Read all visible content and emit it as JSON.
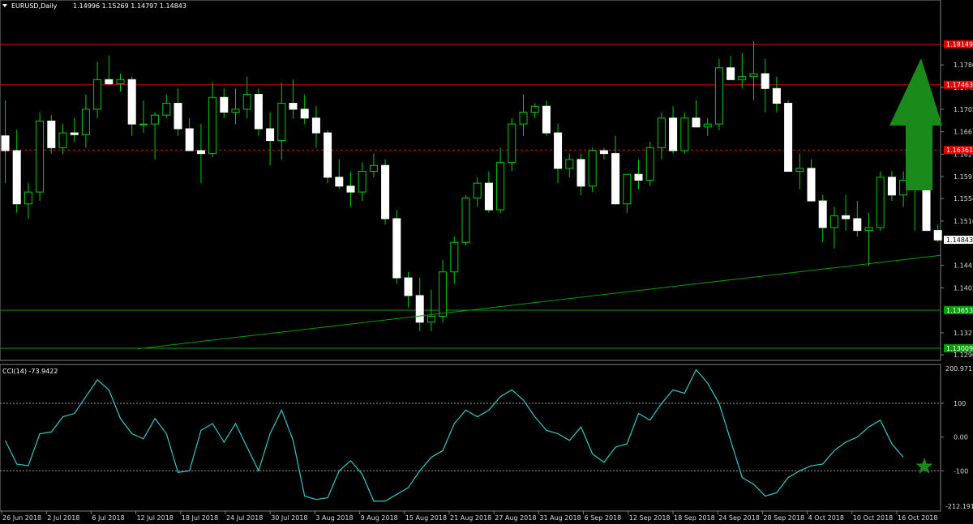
{
  "header": {
    "symbol": "EURUSD,Daily",
    "ohlc": "1.14996 1.15269 1.14797 1.14843"
  },
  "indicator": {
    "label": "CCI(14) -73.9422",
    "top_label": "200.9715",
    "bottom_label": "-212.1911"
  },
  "colors": {
    "background": "#000000",
    "candle_up": "#000000",
    "candle_down": "#ffffff",
    "candle_outline": "#00cc00",
    "resistance": "#e00000",
    "support": "#00a000",
    "trendline": "#00a000",
    "cci_line": "#32c8c8",
    "arrow": "#1a8a1a",
    "star": "#1a8a1a"
  },
  "chart_data": [
    {
      "type": "candlestick",
      "title": "EURUSD,Daily",
      "ylim": [
        1.129,
        1.1865
      ],
      "y_ticks": [
        "1.17800",
        "1.17420",
        "1.17050",
        "1.16670",
        "1.16290",
        "1.15910",
        "1.15540",
        "1.15160",
        "1.14410",
        "1.14030",
        "1.13270",
        "1.12900"
      ],
      "x_ticks": [
        "26 Jun 2018",
        "2 Jul 2018",
        "6 Jul 2018",
        "12 Jul 2018",
        "18 Jul 2018",
        "24 Jul 2018",
        "30 Jul 2018",
        "3 Aug 2018",
        "9 Aug 2018",
        "15 Aug 2018",
        "21 Aug 2018",
        "27 Aug 2018",
        "31 Aug 2018",
        "6 Sep 2018",
        "12 Sep 2018",
        "18 Sep 2018",
        "24 Sep 2018",
        "28 Sep 2018",
        "4 Oct 2018",
        "10 Oct 2018",
        "16 Oct 2018"
      ],
      "price_labels": [
        {
          "text": "1.18149",
          "value": 1.18149,
          "kind": "resistance"
        },
        {
          "text": "1.17463",
          "value": 1.17463,
          "kind": "resistance"
        },
        {
          "text": "1.16361",
          "value": 1.16361,
          "kind": "resistance-dashed"
        },
        {
          "text": "1.14843",
          "value": 1.14843,
          "kind": "current"
        },
        {
          "text": "1.13653",
          "value": 1.13653,
          "kind": "support"
        },
        {
          "text": "1.13009",
          "value": 1.13009,
          "kind": "support"
        }
      ],
      "trendline": {
        "from": [
          9,
          1.13
        ],
        "to": [
          80,
          1.1458
        ]
      },
      "arrow": "up",
      "candles": [
        [
          1.166,
          1.172,
          1.158,
          1.1635
        ],
        [
          1.1635,
          1.167,
          1.153,
          1.1545
        ],
        [
          1.1545,
          1.158,
          1.152,
          1.1565
        ],
        [
          1.1565,
          1.17,
          1.155,
          1.1685
        ],
        [
          1.1685,
          1.1695,
          1.163,
          1.164
        ],
        [
          1.164,
          1.168,
          1.163,
          1.1665
        ],
        [
          1.1665,
          1.169,
          1.165,
          1.1662
        ],
        [
          1.1662,
          1.173,
          1.164,
          1.1705
        ],
        [
          1.1705,
          1.1785,
          1.169,
          1.1755
        ],
        [
          1.1755,
          1.1795,
          1.1745,
          1.1748
        ],
        [
          1.1748,
          1.1765,
          1.1735,
          1.1755
        ],
        [
          1.1755,
          1.176,
          1.166,
          1.168
        ],
        [
          1.168,
          1.172,
          1.1665,
          1.168
        ],
        [
          1.168,
          1.17,
          1.162,
          1.1695
        ],
        [
          1.1695,
          1.173,
          1.169,
          1.1715
        ],
        [
          1.1715,
          1.174,
          1.166,
          1.1672
        ],
        [
          1.1672,
          1.169,
          1.164,
          1.1635
        ],
        [
          1.1635,
          1.168,
          1.158,
          1.163
        ],
        [
          1.163,
          1.175,
          1.1625,
          1.1725
        ],
        [
          1.1725,
          1.174,
          1.169,
          1.17
        ],
        [
          1.17,
          1.174,
          1.168,
          1.1705
        ],
        [
          1.1705,
          1.176,
          1.169,
          1.173
        ],
        [
          1.173,
          1.174,
          1.166,
          1.1672
        ],
        [
          1.1672,
          1.17,
          1.161,
          1.1652
        ],
        [
          1.1652,
          1.175,
          1.162,
          1.1715
        ],
        [
          1.1715,
          1.1755,
          1.169,
          1.1705
        ],
        [
          1.1705,
          1.173,
          1.168,
          1.169
        ],
        [
          1.169,
          1.171,
          1.164,
          1.1665
        ],
        [
          1.1665,
          1.167,
          1.158,
          1.159
        ],
        [
          1.159,
          1.162,
          1.157,
          1.1575
        ],
        [
          1.1575,
          1.16,
          1.154,
          1.1565
        ],
        [
          1.1565,
          1.1615,
          1.155,
          1.16
        ],
        [
          1.16,
          1.163,
          1.159,
          1.161
        ],
        [
          1.161,
          1.162,
          1.151,
          1.152
        ],
        [
          1.152,
          1.1535,
          1.141,
          1.142
        ],
        [
          1.142,
          1.143,
          1.137,
          1.139
        ],
        [
          1.139,
          1.142,
          1.133,
          1.1345
        ],
        [
          1.1345,
          1.14,
          1.133,
          1.1355
        ],
        [
          1.1355,
          1.145,
          1.1345,
          1.143
        ],
        [
          1.143,
          1.149,
          1.141,
          1.148
        ],
        [
          1.148,
          1.156,
          1.1475,
          1.1555
        ],
        [
          1.1555,
          1.159,
          1.154,
          1.158
        ],
        [
          1.158,
          1.16,
          1.153,
          1.1535
        ],
        [
          1.1535,
          1.164,
          1.153,
          1.1615
        ],
        [
          1.1615,
          1.169,
          1.16,
          1.168
        ],
        [
          1.168,
          1.173,
          1.166,
          1.17
        ],
        [
          1.17,
          1.1715,
          1.169,
          1.171
        ],
        [
          1.171,
          1.172,
          1.166,
          1.1665
        ],
        [
          1.1665,
          1.168,
          1.158,
          1.1605
        ],
        [
          1.1605,
          1.163,
          1.159,
          1.162
        ],
        [
          1.162,
          1.163,
          1.156,
          1.1575
        ],
        [
          1.1575,
          1.164,
          1.1565,
          1.1635
        ],
        [
          1.1635,
          1.164,
          1.162,
          1.163
        ],
        [
          1.163,
          1.166,
          1.162,
          1.1545
        ],
        [
          1.1545,
          1.159,
          1.153,
          1.1595
        ],
        [
          1.1595,
          1.162,
          1.157,
          1.1585
        ],
        [
          1.1585,
          1.165,
          1.1575,
          1.164
        ],
        [
          1.164,
          1.17,
          1.162,
          1.169
        ],
        [
          1.169,
          1.171,
          1.163,
          1.1635
        ],
        [
          1.1635,
          1.17,
          1.163,
          1.169
        ],
        [
          1.169,
          1.172,
          1.168,
          1.1675
        ],
        [
          1.1675,
          1.169,
          1.166,
          1.168
        ],
        [
          1.168,
          1.179,
          1.167,
          1.1775
        ],
        [
          1.1775,
          1.1795,
          1.1755,
          1.1755
        ],
        [
          1.1755,
          1.18,
          1.174,
          1.176
        ],
        [
          1.176,
          1.182,
          1.172,
          1.1765
        ],
        [
          1.1765,
          1.179,
          1.17,
          1.174
        ],
        [
          1.174,
          1.176,
          1.17,
          1.1715
        ],
        [
          1.1715,
          1.172,
          1.162,
          1.16
        ],
        [
          1.16,
          1.163,
          1.157,
          1.1605
        ],
        [
          1.1605,
          1.162,
          1.156,
          1.155
        ],
        [
          1.155,
          1.156,
          1.148,
          1.1505
        ],
        [
          1.1505,
          1.154,
          1.147,
          1.1525
        ],
        [
          1.1525,
          1.156,
          1.15,
          1.152
        ],
        [
          1.152,
          1.155,
          1.149,
          1.15
        ],
        [
          1.15,
          1.153,
          1.144,
          1.1505
        ],
        [
          1.1505,
          1.16,
          1.15,
          1.159
        ],
        [
          1.159,
          1.16,
          1.155,
          1.156
        ],
        [
          1.156,
          1.16,
          1.154,
          1.1585
        ],
        [
          1.1585,
          1.161,
          1.15,
          1.158
        ],
        [
          1.158,
          1.16,
          1.15,
          1.15
        ],
        [
          1.15,
          1.151,
          1.148,
          1.1484
        ]
      ]
    },
    {
      "type": "line",
      "title": "CCI(14) -73.9422",
      "ylim": [
        -212.1911,
        200.9715
      ],
      "y_ticks": [
        "200.9715",
        "100",
        "0.00",
        "-100",
        "-212.1911"
      ],
      "levels": [
        100,
        -100
      ],
      "values": [
        -10,
        -80,
        -85,
        10,
        15,
        60,
        70,
        120,
        170,
        140,
        55,
        10,
        -5,
        55,
        10,
        -105,
        -100,
        20,
        40,
        -15,
        40,
        -30,
        -100,
        10,
        80,
        -10,
        -175,
        -185,
        -180,
        -100,
        -70,
        -110,
        -190,
        -190,
        -170,
        -150,
        -100,
        -60,
        -40,
        40,
        80,
        60,
        80,
        120,
        140,
        110,
        60,
        20,
        10,
        -10,
        30,
        -50,
        -75,
        -30,
        -20,
        70,
        50,
        100,
        140,
        130,
        200,
        160,
        100,
        -10,
        -120,
        -140,
        -175,
        -165,
        -120,
        -100,
        -85,
        -80,
        -40,
        -15,
        0,
        30,
        50,
        -20,
        -60
      ]
    }
  ]
}
